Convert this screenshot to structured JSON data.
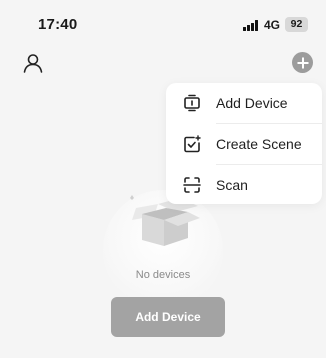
{
  "status_bar": {
    "time": "17:40",
    "network": "4G",
    "battery": "92"
  },
  "header": {
    "profile_icon": "person-icon",
    "add_icon": "plus-circle-icon"
  },
  "menu": {
    "items": [
      {
        "label": "Add Device",
        "icon": "device-add-icon"
      },
      {
        "label": "Create Scene",
        "icon": "scene-check-icon"
      },
      {
        "label": "Scan",
        "icon": "scan-icon"
      }
    ]
  },
  "empty_state": {
    "message": "No devices",
    "illustration": "empty-box-icon",
    "button_label": "Add Device"
  },
  "colors": {
    "background": "#f5f5f5",
    "menu_background": "#ffffff",
    "button_gray": "#a3a3a3",
    "add_circle": "#9c9c9c"
  }
}
